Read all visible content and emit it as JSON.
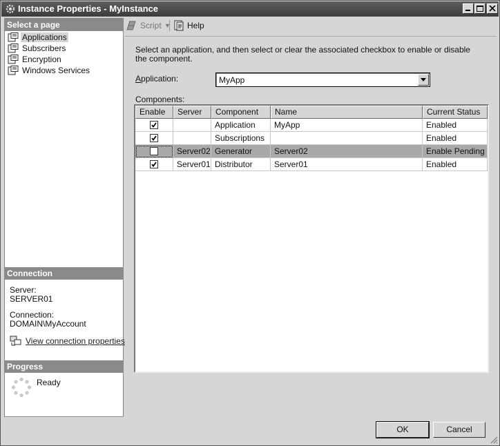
{
  "window": {
    "title": "Instance Properties - MyInstance"
  },
  "left_pane": {
    "select_page_header": "Select a page",
    "pages": [
      {
        "label": "Applications",
        "selected": true
      },
      {
        "label": "Subscribers",
        "selected": false
      },
      {
        "label": "Encryption",
        "selected": false
      },
      {
        "label": "Windows Services",
        "selected": false
      }
    ],
    "connection_header": "Connection",
    "server_label": "Server:",
    "server_value": "SERVER01",
    "connection_label": "Connection:",
    "connection_value": "DOMAIN\\MyAccount",
    "view_connection_link": "View connection properties",
    "progress_header": "Progress",
    "progress_status": "Ready"
  },
  "toolbar": {
    "script_label": "Script",
    "help_label": "Help"
  },
  "main": {
    "description": "Select an application, and then select or clear the associated checkbox to enable or disable the component.",
    "application_label": "Application:",
    "application_value": "MyApp",
    "components_label": "Components:",
    "columns": [
      "Enable",
      "Server",
      "Component",
      "Name",
      "Current Status"
    ],
    "rows": [
      {
        "enabled": true,
        "server": "",
        "component": "Application",
        "name": "MyApp",
        "status": "Enabled",
        "highlighted": false
      },
      {
        "enabled": true,
        "server": "",
        "component": "Subscriptions",
        "name": "",
        "status": "Enabled",
        "highlighted": false
      },
      {
        "enabled": false,
        "server": "Server02",
        "component": "Generator",
        "name": "Server02",
        "status": "Enable Pending",
        "highlighted": true
      },
      {
        "enabled": true,
        "server": "Server01",
        "component": "Distributor",
        "name": "Server01",
        "status": "Enabled",
        "highlighted": false
      }
    ]
  },
  "buttons": {
    "ok": "OK",
    "cancel": "Cancel"
  },
  "icons": {
    "app": "gear-icon",
    "page": "properties-page-icon",
    "connection": "connection-properties-icon",
    "progress": "spinner-icon",
    "script": "script-icon",
    "help": "help-icon"
  },
  "colors": {
    "title_bar": "#4a4a4a",
    "pane_header": "#8a8a8a",
    "highlight_row": "#a9a9a9",
    "window_bg": "#d6d6d6"
  }
}
